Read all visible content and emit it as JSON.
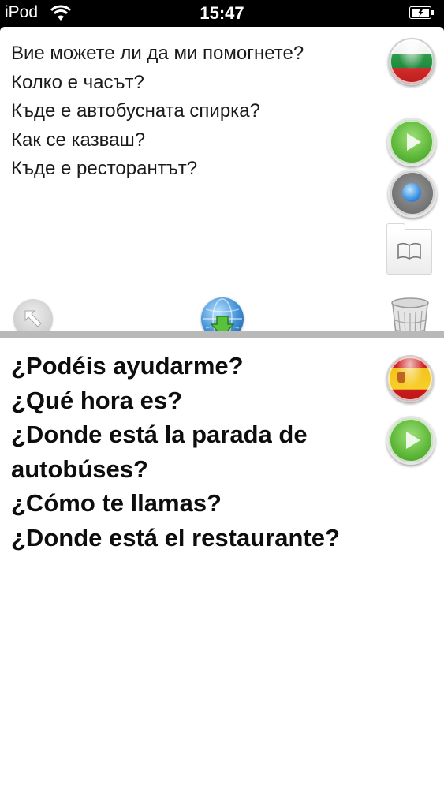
{
  "status_bar": {
    "carrier": "iPod",
    "time": "15:47"
  },
  "source": {
    "language_flag": "bulgaria-flag-icon",
    "lines": [
      "Вие можете ли да ми помогнете?",
      "Колко е часът?",
      "Къде е автобусната спирка?",
      "Как се казваш?",
      "Къде е ресторантът?"
    ]
  },
  "target": {
    "language_flag": "spain-flag-icon",
    "lines": [
      "¿Podéis ayudarme?",
      "¿Qué hora es?",
      "¿Donde está la parada de autobúses?",
      "¿Cómo te llamas?",
      "¿Donde está el restaurante?"
    ]
  },
  "colors": {
    "panel_bg": "#ffffff",
    "divider": "#b9b9b9",
    "play_green": "#5fb93a",
    "record_blue": "#3a8fe0"
  }
}
